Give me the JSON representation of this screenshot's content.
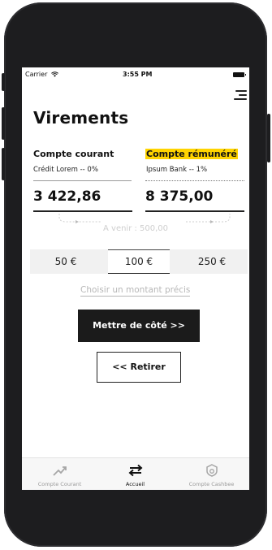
{
  "status_bar": {
    "carrier": "Carrier",
    "time": "3:55 PM"
  },
  "header": {
    "title": "Virements",
    "menu_icon": "hamburger-menu-icon"
  },
  "accounts": {
    "left": {
      "label": "Compte courant",
      "bank": "Crédit Lorem -- 0%",
      "amount": "3 422,86"
    },
    "right": {
      "label": "Compte rémunéré",
      "bank": "Ipsum Bank -- 1%",
      "amount": "8 375,00"
    }
  },
  "transfer": {
    "pending": "A venir : 500,00"
  },
  "amount_options": [
    "50 €",
    "100 €",
    "250 €"
  ],
  "selected_amount": "100 €",
  "choose_amount": "Choisir un montant précis",
  "actions": {
    "save": "Mettre de côté >>",
    "withdraw": "<< Retirer"
  },
  "tabbar": {
    "tabs": [
      {
        "label": "Compte Courant",
        "icon": "trending-up-icon",
        "active": false
      },
      {
        "label": "Accueil",
        "icon": "transfer-arrows-icon",
        "active": true
      },
      {
        "label": "Compte Cashbee",
        "icon": "shield-icon",
        "active": false
      }
    ]
  },
  "colors": {
    "highlight": "#ffd400",
    "primary_button": "#1b1b1b",
    "muted_text": "#b7b7b7"
  }
}
